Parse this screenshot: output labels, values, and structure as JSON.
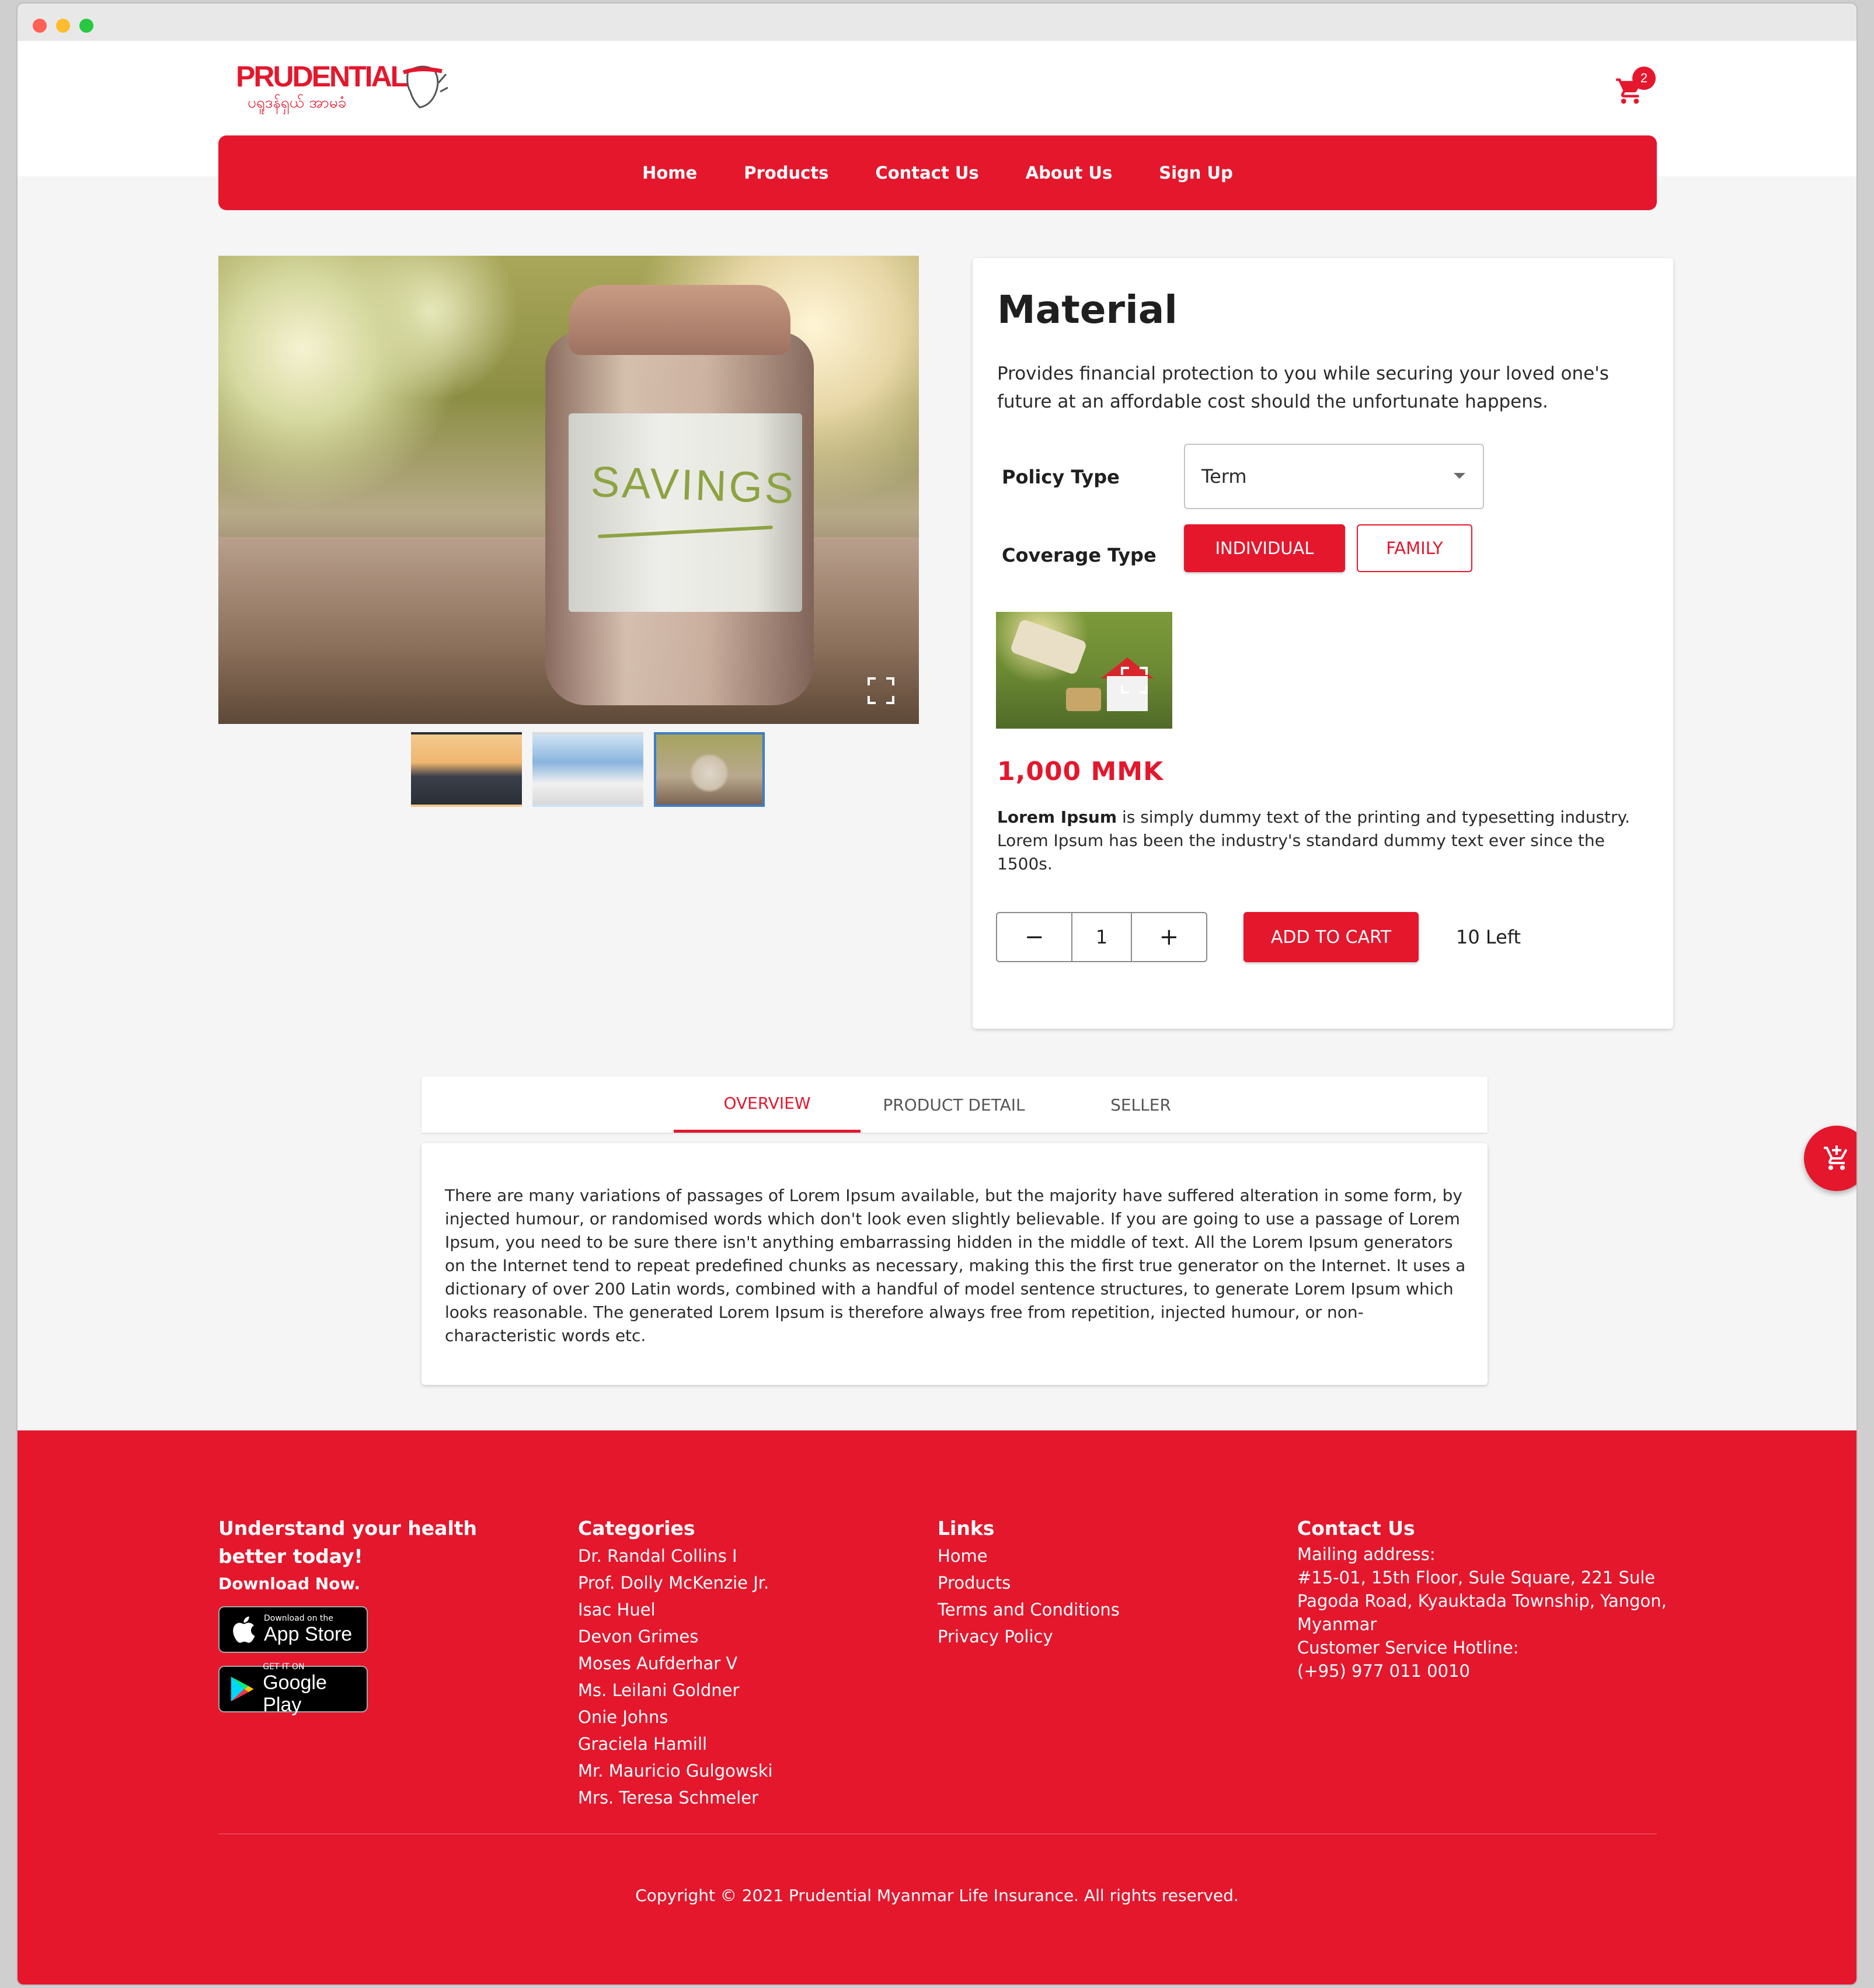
{
  "brand": {
    "name": "PRUDENTIAL",
    "tagline": "ပရူဒန်ရှယ် အာမခံ"
  },
  "cart": {
    "count": "2"
  },
  "nav": {
    "items": [
      "Home",
      "Products",
      "Contact Us",
      "About Us",
      "Sign Up"
    ]
  },
  "product": {
    "title": "Material",
    "description": "Provides financial protection to you while securing your loved one's future at an affordable cost should the unfortunate happens.",
    "image_text": "SAVINGS",
    "policy_label": "Policy Type",
    "policy_value": "Term",
    "coverage_label": "Coverage Type",
    "coverage_options": [
      "INDIVIDUAL",
      "FAMILY"
    ],
    "coverage_selected": "INDIVIDUAL",
    "price": "1,000 MMK",
    "lorem_bold": "Lorem Ipsum",
    "lorem_rest": " is simply dummy text of the printing and typesetting industry. Lorem Ipsum has been the industry's standard dummy text ever since the 1500s.",
    "quantity": "1",
    "minus": "−",
    "plus": "+",
    "add_to_cart": "ADD TO CART",
    "stock": "10 Left"
  },
  "tabs": {
    "items": [
      "OVERVIEW",
      "PRODUCT DETAIL",
      "SELLER"
    ],
    "active": "OVERVIEW",
    "overview_text": "There are many variations of passages of Lorem Ipsum available, but the majority have suffered alteration in some form, by injected humour, or randomised words which don't look even slightly believable. If you are going to use a passage of Lorem Ipsum, you need to be sure there isn't anything embarrassing hidden in the middle of text. All the Lorem Ipsum generators on the Internet tend to repeat predefined chunks as necessary, making this the first true generator on the Internet. It uses a dictionary of over 200 Latin words, combined with a handful of model sentence structures, to generate Lorem Ipsum which looks reasonable. The generated Lorem Ipsum is therefore always free from repetition, injected humour, or non-characteristic words etc."
  },
  "footer": {
    "download": {
      "heading": "Understand your health better today!",
      "sub": "Download Now.",
      "appstore_small": "Download on the",
      "appstore_big": "App Store",
      "googleplay_small": "GET IT ON",
      "googleplay_big": "Google Play"
    },
    "categories": {
      "heading": "Categories",
      "items": [
        "Dr. Randal Collins I",
        "Prof. Dolly McKenzie Jr.",
        "Isac Huel",
        "Devon Grimes",
        "Moses Aufderhar V",
        "Ms. Leilani Goldner",
        "Onie Johns",
        "Graciela Hamill",
        "Mr. Mauricio Gulgowski",
        "Mrs. Teresa Schmeler"
      ]
    },
    "links": {
      "heading": "Links",
      "items": [
        "Home",
        "Products",
        "Terms and Conditions",
        "Privacy Policy"
      ]
    },
    "contact": {
      "heading": "Contact Us",
      "mailing_label": "Mailing address:",
      "address": "#15-01, 15th Floor, Sule Square, 221 Sule Pagoda Road, Kyauktada Township, Yangon, Myanmar",
      "hotline_label": "Customer Service Hotline:",
      "hotline": "(+95) 977 011 0010"
    },
    "copyright": "Copyright © 2021 Prudential Myanmar Life Insurance. All rights reserved."
  },
  "colors": {
    "brand_red": "#e4172d",
    "thumb_active_border": "#3d7ec5"
  }
}
